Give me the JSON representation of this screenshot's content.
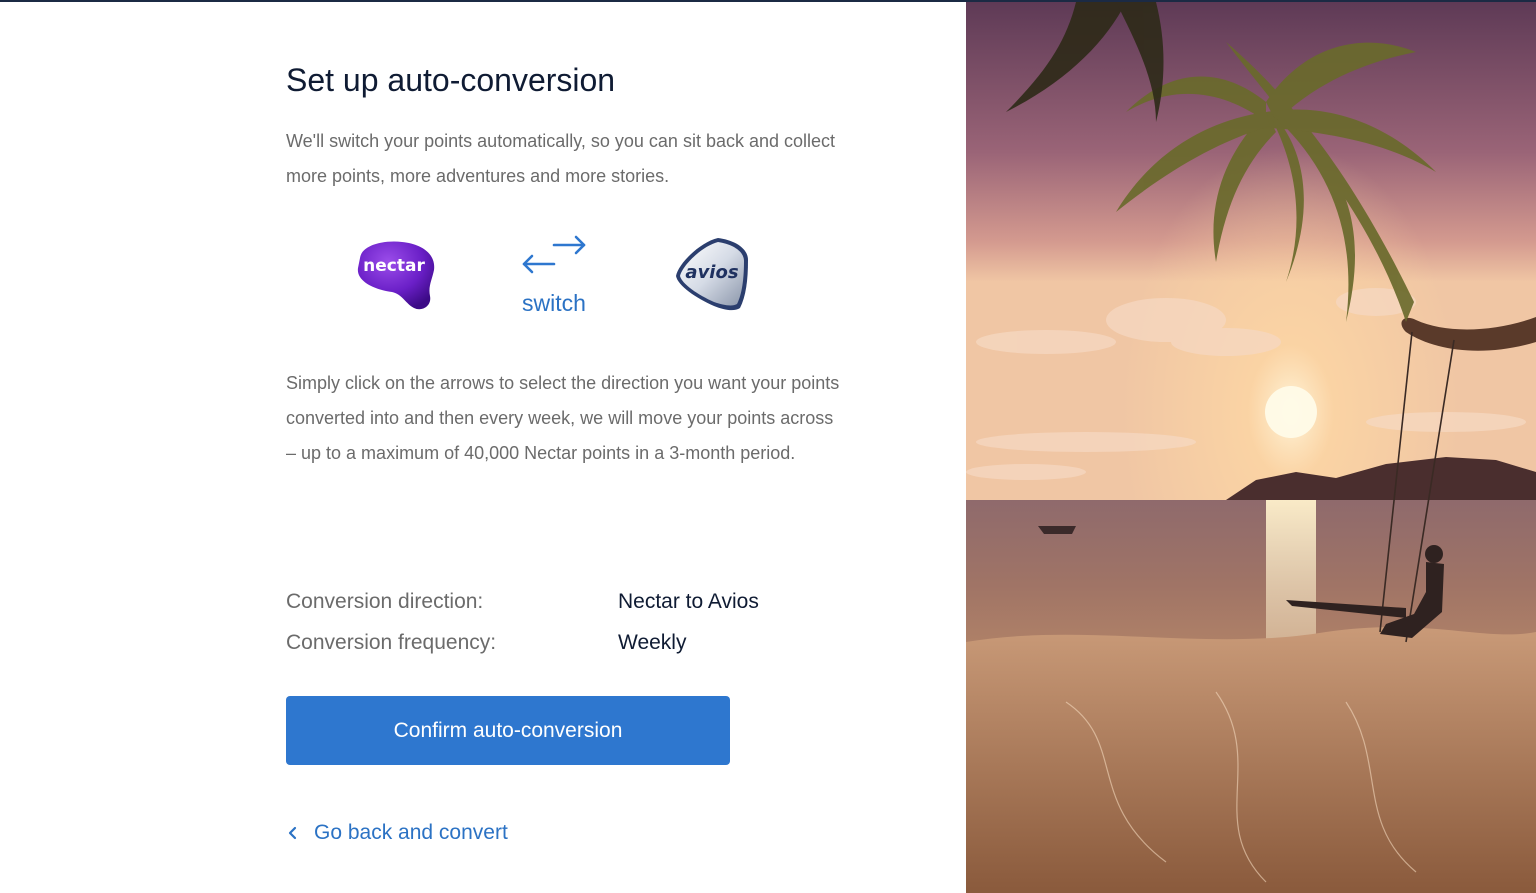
{
  "page": {
    "title": "Set up auto-conversion",
    "intro": "We'll switch your points automatically, so you can sit back and collect more points, more adventures and more stories.",
    "instructions": "Simply click on the arrows to select the direction you want your points converted into and then every week, we will move your points across – up to a maximum of 40,000 Nectar points in a 3-month period."
  },
  "logos": {
    "nectar": "nectar",
    "switch_label": "switch",
    "avios": "avios"
  },
  "summary": {
    "direction_label": "Conversion direction:",
    "direction_value": "Nectar to Avios",
    "frequency_label": "Conversion frequency:",
    "frequency_value": "Weekly"
  },
  "actions": {
    "confirm_label": "Confirm auto-conversion",
    "back_label": "Go back and convert"
  },
  "icons": {
    "switch": "swap-arrows-icon",
    "back": "chevron-left-icon"
  },
  "colors": {
    "accent": "#2e77cf",
    "link": "#2b72c4",
    "heading": "#0f1b33",
    "body_text": "#6b6b6b",
    "nectar_purple": "#6a1fc7"
  }
}
